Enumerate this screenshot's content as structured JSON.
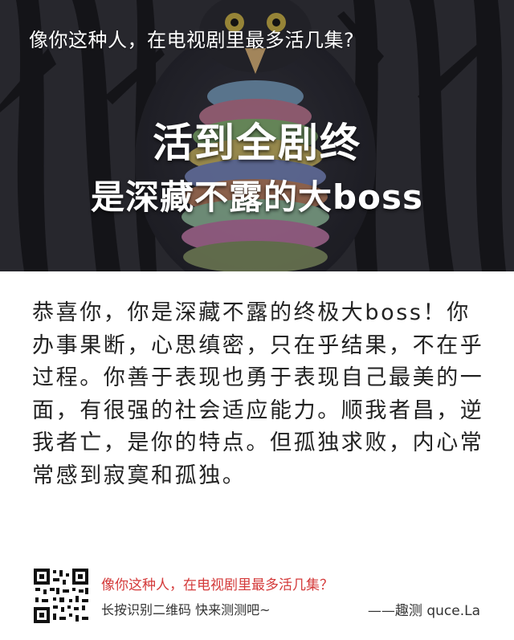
{
  "hero": {
    "question": "像你这种人，在电视剧里最多活几集?",
    "title": "活到全剧终",
    "subtitle": "是深藏不露的大boss"
  },
  "result": {
    "text": "恭喜你，你是深藏不露的终极大boss！你办事果断，心思缜密，只在乎结果，不在乎过程。你善于表现也勇于表现自己最美的一面，有很强的社会适应能力。顺我者昌，逆我者亡，是你的特点。但孤独求败，内心常常感到寂寞和孤独。"
  },
  "footer": {
    "question": "像你这种人，在电视剧里最多活几集？",
    "hint": "长按识别二维码  快来测测吧~",
    "brand": "——趣测 quce.La"
  },
  "colors": {
    "accent_red": "#d43a3a",
    "hero_bg": "#2a2a31"
  },
  "icons": {
    "qr": "qr-code-icon",
    "illustration": "owl-in-forest-illustration"
  }
}
